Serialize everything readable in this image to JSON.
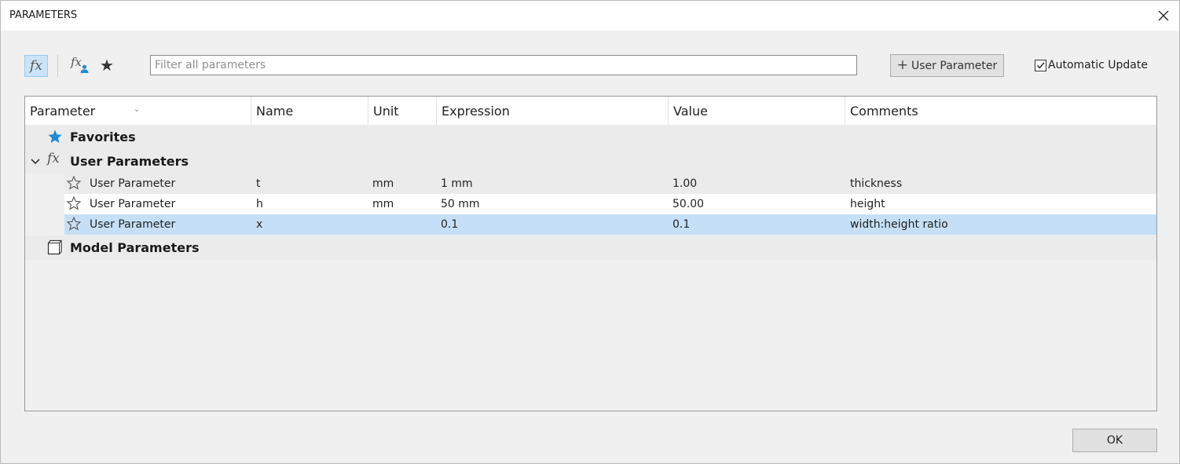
{
  "window": {
    "title": "PARAMETERS"
  },
  "toolbar": {
    "fx_glyph": "fx",
    "fx_user_glyph": "fx",
    "star_glyph": "★",
    "filter_placeholder": "Filter all parameters",
    "filter_value": "",
    "add_button_label": "User Parameter",
    "auto_update_label": "Automatic Update",
    "auto_update_checked": true
  },
  "table": {
    "columns": [
      "Parameter",
      "Name",
      "Unit",
      "Expression",
      "Value",
      "Comments"
    ],
    "groups": [
      {
        "label": "Favorites",
        "icon": "star-filled-icon"
      },
      {
        "label": "User Parameters",
        "icon": "fx-icon",
        "expanded": true
      },
      {
        "label": "Model Parameters",
        "icon": "cube-icon"
      }
    ],
    "rows": [
      {
        "parameter": "User Parameter",
        "name": "t",
        "unit": "mm",
        "expression": "1 mm",
        "value": "1.00",
        "comments": "thickness"
      },
      {
        "parameter": "User Parameter",
        "name": "h",
        "unit": "mm",
        "expression": "50 mm",
        "value": "50.00",
        "comments": "height"
      },
      {
        "parameter": "User Parameter",
        "name": "x",
        "unit": "",
        "expression": "0.1",
        "value": "0.1",
        "comments": "width:height ratio",
        "selected": true
      }
    ]
  },
  "footer": {
    "ok_label": "OK"
  },
  "colors": {
    "accent": "#1c8ed4",
    "selected_row": "#c5dff6",
    "toolbar_active": "#cce4f7"
  }
}
